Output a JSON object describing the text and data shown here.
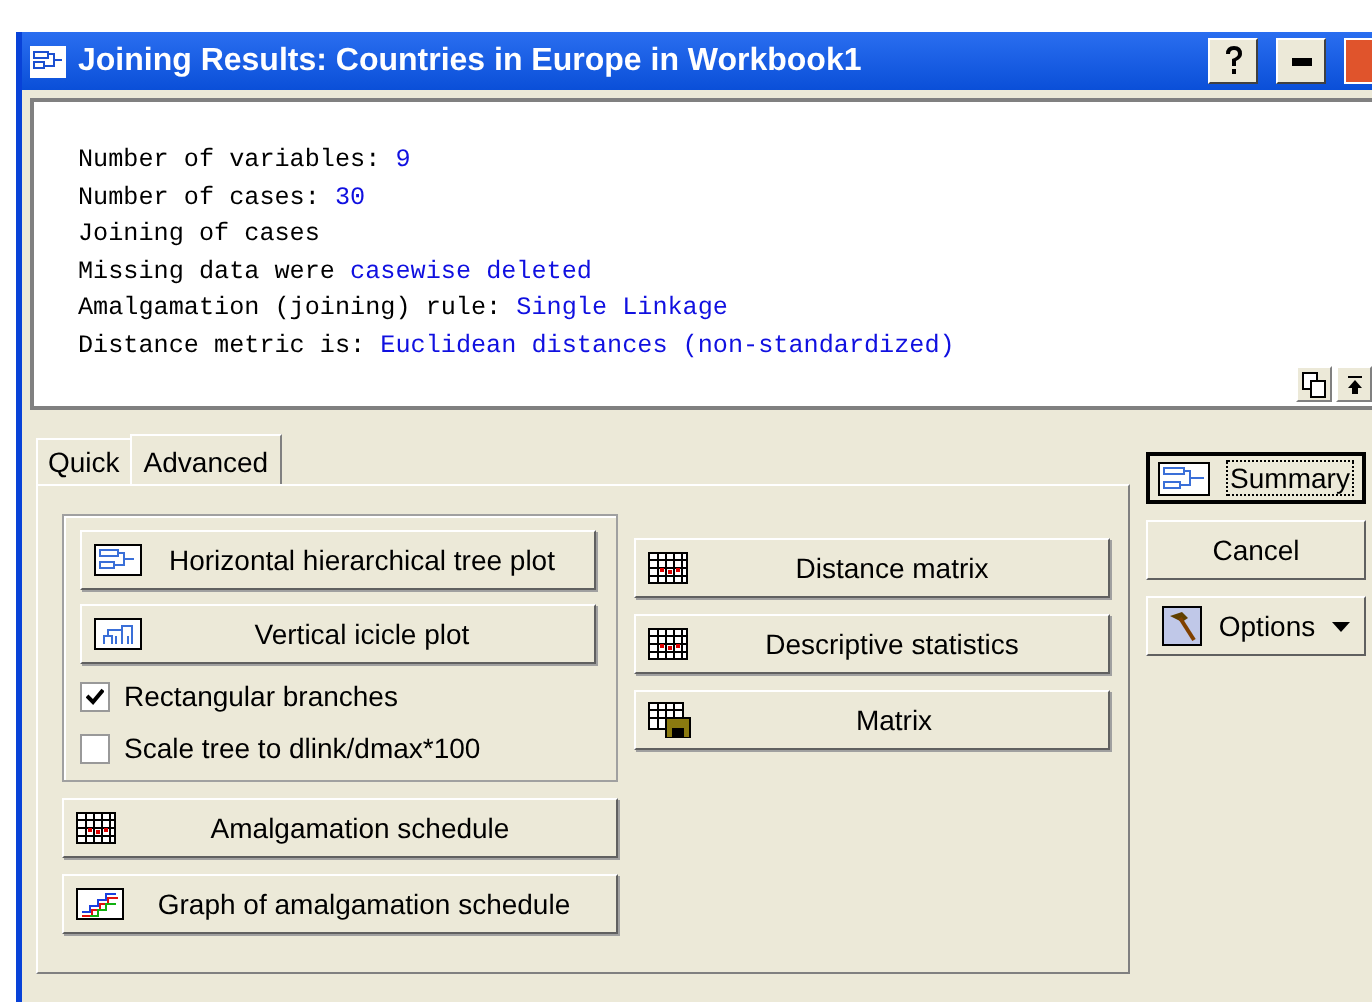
{
  "window": {
    "title": "Joining Results: Countries in Europe in Workbook1"
  },
  "output_lines": [
    {
      "label": "Number of variables: ",
      "value": "9"
    },
    {
      "label": "Number of cases: ",
      "value": "30"
    },
    {
      "label": "Joining of cases"
    },
    {
      "label": "Missing data were ",
      "value": "casewise deleted"
    },
    {
      "label": "Amalgamation (joining) rule: ",
      "value": "Single Linkage"
    },
    {
      "label": "Distance metric is: ",
      "value": "Euclidean distances (non-standardized)"
    }
  ],
  "tabs": [
    {
      "label": "Quick",
      "selected": false
    },
    {
      "label": "Advanced",
      "selected": true
    }
  ],
  "group_buttons": [
    {
      "label": "Horizontal hierarchical tree plot",
      "kind": "htree"
    },
    {
      "label": "Vertical icicle plot",
      "kind": "vtree"
    }
  ],
  "checkboxes": [
    {
      "label": "Rectangular branches",
      "checked": true
    },
    {
      "label": "Scale tree to dlink/dmax*100",
      "checked": false
    }
  ],
  "left_buttons": [
    {
      "label": "Amalgamation schedule",
      "kind": "grid"
    },
    {
      "label": "Graph of amalgamation schedule",
      "kind": "graph"
    }
  ],
  "right_buttons": [
    {
      "label": "Distance matrix",
      "kind": "grid"
    },
    {
      "label": "Descriptive statistics",
      "kind": "grid"
    },
    {
      "label": "Matrix",
      "kind": "gridsave"
    }
  ],
  "side_buttons": [
    {
      "label": "Summary",
      "kind": "summary"
    },
    {
      "label": "Cancel",
      "kind": "plain"
    },
    {
      "label": "Options",
      "kind": "menu"
    }
  ]
}
